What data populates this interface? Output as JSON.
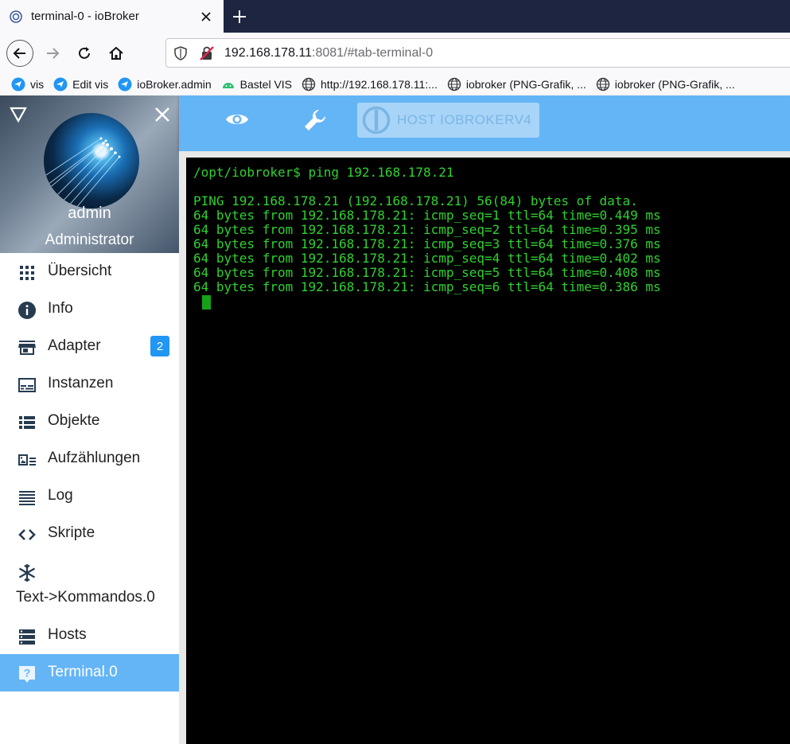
{
  "browser": {
    "tab_title": "terminal-0 - ioBroker",
    "url_host": "192.168.178.11",
    "url_rest": ":8081/#tab-terminal-0",
    "bookmarks": [
      {
        "label": "vis",
        "icon": "vis-icon"
      },
      {
        "label": "Edit vis",
        "icon": "vis-icon"
      },
      {
        "label": "ioBroker.admin",
        "icon": "vis-icon"
      },
      {
        "label": "Bastel VIS",
        "icon": "android-icon"
      },
      {
        "label": "http://192.168.178.11:...",
        "icon": "globe-icon"
      },
      {
        "label": "iobroker (PNG-Grafik, ...",
        "icon": "globe-icon"
      },
      {
        "label": "iobroker (PNG-Grafik, ...",
        "icon": "globe-icon"
      }
    ]
  },
  "sidebar": {
    "user_name": "admin",
    "user_role": "Administrator",
    "items": [
      {
        "label": "Übersicht",
        "icon": "apps-grid-icon"
      },
      {
        "label": "Info",
        "icon": "info-icon"
      },
      {
        "label": "Adapter",
        "icon": "store-icon",
        "badge": "2"
      },
      {
        "label": "Instanzen",
        "icon": "instances-icon"
      },
      {
        "label": "Objekte",
        "icon": "list-icon"
      },
      {
        "label": "Aufzählungen",
        "icon": "enum-icon"
      },
      {
        "label": "Log",
        "icon": "log-lines-icon"
      },
      {
        "label": "Skripte",
        "icon": "code-icon"
      },
      {
        "label": "Text->Kommandos.0",
        "icon": "snowflake-icon"
      },
      {
        "label": "Hosts",
        "icon": "storage-icon"
      },
      {
        "label": "Terminal.0",
        "icon": "help-box-icon",
        "active": true
      }
    ]
  },
  "appbar": {
    "host_label": "HOST IOBROKERV4"
  },
  "terminal": {
    "prompt": "/opt/iobroker$ ping 192.168.178.21",
    "lines": [
      "PING 192.168.178.21 (192.168.178.21) 56(84) bytes of data.",
      "64 bytes from 192.168.178.21: icmp_seq=1 ttl=64 time=0.449 ms",
      "64 bytes from 192.168.178.21: icmp_seq=2 ttl=64 time=0.395 ms",
      "64 bytes from 192.168.178.21: icmp_seq=3 ttl=64 time=0.376 ms",
      "64 bytes from 192.168.178.21: icmp_seq=4 ttl=64 time=0.402 ms",
      "64 bytes from 192.168.178.21: icmp_seq=5 ttl=64 time=0.408 ms",
      "64 bytes from 192.168.178.21: icmp_seq=6 ttl=64 time=0.386 ms"
    ]
  },
  "colors": {
    "appbar": "#64b5f6",
    "active_item": "#64b5f6",
    "badge": "#2196f3",
    "terminal_text": "#2fd12f",
    "tabbar": "#1e2540"
  }
}
